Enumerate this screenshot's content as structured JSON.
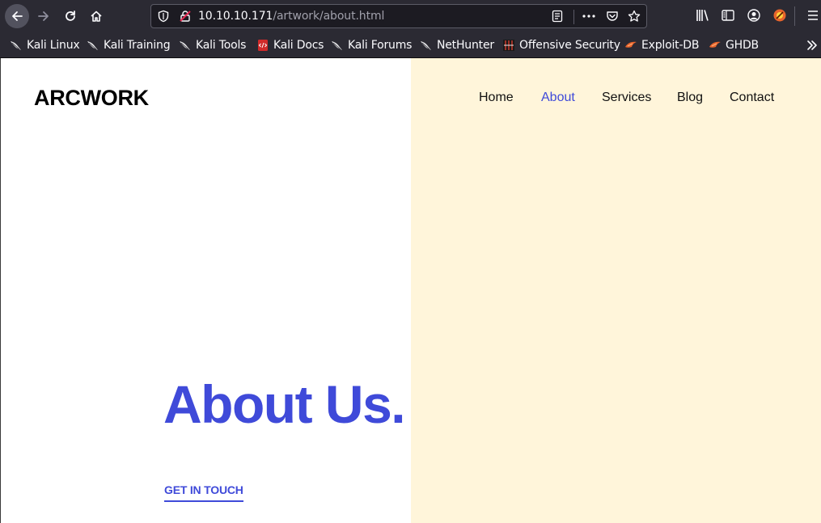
{
  "browser": {
    "url_host": "10.10.10.171",
    "url_path": "/artwork/about.html",
    "bookmarks": [
      {
        "label": "Kali Linux",
        "icon": "kali-dragon-icon"
      },
      {
        "label": "Kali Training",
        "icon": "kali-dragon-icon"
      },
      {
        "label": "Kali Tools",
        "icon": "kali-dragon-icon"
      },
      {
        "label": "Kali Docs",
        "icon": "kali-docs-icon"
      },
      {
        "label": "Kali Forums",
        "icon": "kali-dragon-icon"
      },
      {
        "label": "NetHunter",
        "icon": "kali-dragon-icon"
      },
      {
        "label": "Offensive Security",
        "icon": "offsec-icon"
      },
      {
        "label": "Exploit-DB",
        "icon": "exploitdb-icon"
      },
      {
        "label": "GHDB",
        "icon": "exploitdb-icon"
      }
    ],
    "colors": {
      "chrome": "#2b2a33",
      "urlbar": "#1c1b22",
      "text": "#fbfbfe"
    }
  },
  "site": {
    "brand": "ARCWORK",
    "nav": [
      "Home",
      "About",
      "Services",
      "Blog",
      "Contact"
    ],
    "active_nav": "About",
    "hero_title": "About Us.",
    "cta_label": "GET IN TOUCH",
    "colors": {
      "accent": "#3f4ad9",
      "panel": "#fff5da",
      "text": "#000000"
    }
  }
}
